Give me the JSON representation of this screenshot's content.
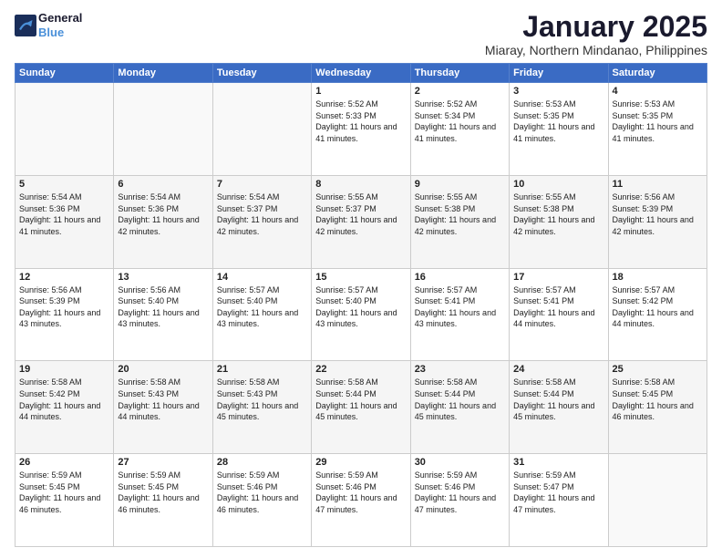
{
  "logo": {
    "line1": "General",
    "line2": "Blue"
  },
  "title": "January 2025",
  "location": "Miaray, Northern Mindanao, Philippines",
  "days_header": [
    "Sunday",
    "Monday",
    "Tuesday",
    "Wednesday",
    "Thursday",
    "Friday",
    "Saturday"
  ],
  "weeks": [
    [
      {
        "day": "",
        "sunrise": "",
        "sunset": "",
        "daylight": ""
      },
      {
        "day": "",
        "sunrise": "",
        "sunset": "",
        "daylight": ""
      },
      {
        "day": "",
        "sunrise": "",
        "sunset": "",
        "daylight": ""
      },
      {
        "day": "1",
        "sunrise": "Sunrise: 5:52 AM",
        "sunset": "Sunset: 5:33 PM",
        "daylight": "Daylight: 11 hours and 41 minutes."
      },
      {
        "day": "2",
        "sunrise": "Sunrise: 5:52 AM",
        "sunset": "Sunset: 5:34 PM",
        "daylight": "Daylight: 11 hours and 41 minutes."
      },
      {
        "day": "3",
        "sunrise": "Sunrise: 5:53 AM",
        "sunset": "Sunset: 5:35 PM",
        "daylight": "Daylight: 11 hours and 41 minutes."
      },
      {
        "day": "4",
        "sunrise": "Sunrise: 5:53 AM",
        "sunset": "Sunset: 5:35 PM",
        "daylight": "Daylight: 11 hours and 41 minutes."
      }
    ],
    [
      {
        "day": "5",
        "sunrise": "Sunrise: 5:54 AM",
        "sunset": "Sunset: 5:36 PM",
        "daylight": "Daylight: 11 hours and 41 minutes."
      },
      {
        "day": "6",
        "sunrise": "Sunrise: 5:54 AM",
        "sunset": "Sunset: 5:36 PM",
        "daylight": "Daylight: 11 hours and 42 minutes."
      },
      {
        "day": "7",
        "sunrise": "Sunrise: 5:54 AM",
        "sunset": "Sunset: 5:37 PM",
        "daylight": "Daylight: 11 hours and 42 minutes."
      },
      {
        "day": "8",
        "sunrise": "Sunrise: 5:55 AM",
        "sunset": "Sunset: 5:37 PM",
        "daylight": "Daylight: 11 hours and 42 minutes."
      },
      {
        "day": "9",
        "sunrise": "Sunrise: 5:55 AM",
        "sunset": "Sunset: 5:38 PM",
        "daylight": "Daylight: 11 hours and 42 minutes."
      },
      {
        "day": "10",
        "sunrise": "Sunrise: 5:55 AM",
        "sunset": "Sunset: 5:38 PM",
        "daylight": "Daylight: 11 hours and 42 minutes."
      },
      {
        "day": "11",
        "sunrise": "Sunrise: 5:56 AM",
        "sunset": "Sunset: 5:39 PM",
        "daylight": "Daylight: 11 hours and 42 minutes."
      }
    ],
    [
      {
        "day": "12",
        "sunrise": "Sunrise: 5:56 AM",
        "sunset": "Sunset: 5:39 PM",
        "daylight": "Daylight: 11 hours and 43 minutes."
      },
      {
        "day": "13",
        "sunrise": "Sunrise: 5:56 AM",
        "sunset": "Sunset: 5:40 PM",
        "daylight": "Daylight: 11 hours and 43 minutes."
      },
      {
        "day": "14",
        "sunrise": "Sunrise: 5:57 AM",
        "sunset": "Sunset: 5:40 PM",
        "daylight": "Daylight: 11 hours and 43 minutes."
      },
      {
        "day": "15",
        "sunrise": "Sunrise: 5:57 AM",
        "sunset": "Sunset: 5:40 PM",
        "daylight": "Daylight: 11 hours and 43 minutes."
      },
      {
        "day": "16",
        "sunrise": "Sunrise: 5:57 AM",
        "sunset": "Sunset: 5:41 PM",
        "daylight": "Daylight: 11 hours and 43 minutes."
      },
      {
        "day": "17",
        "sunrise": "Sunrise: 5:57 AM",
        "sunset": "Sunset: 5:41 PM",
        "daylight": "Daylight: 11 hours and 44 minutes."
      },
      {
        "day": "18",
        "sunrise": "Sunrise: 5:57 AM",
        "sunset": "Sunset: 5:42 PM",
        "daylight": "Daylight: 11 hours and 44 minutes."
      }
    ],
    [
      {
        "day": "19",
        "sunrise": "Sunrise: 5:58 AM",
        "sunset": "Sunset: 5:42 PM",
        "daylight": "Daylight: 11 hours and 44 minutes."
      },
      {
        "day": "20",
        "sunrise": "Sunrise: 5:58 AM",
        "sunset": "Sunset: 5:43 PM",
        "daylight": "Daylight: 11 hours and 44 minutes."
      },
      {
        "day": "21",
        "sunrise": "Sunrise: 5:58 AM",
        "sunset": "Sunset: 5:43 PM",
        "daylight": "Daylight: 11 hours and 45 minutes."
      },
      {
        "day": "22",
        "sunrise": "Sunrise: 5:58 AM",
        "sunset": "Sunset: 5:44 PM",
        "daylight": "Daylight: 11 hours and 45 minutes."
      },
      {
        "day": "23",
        "sunrise": "Sunrise: 5:58 AM",
        "sunset": "Sunset: 5:44 PM",
        "daylight": "Daylight: 11 hours and 45 minutes."
      },
      {
        "day": "24",
        "sunrise": "Sunrise: 5:58 AM",
        "sunset": "Sunset: 5:44 PM",
        "daylight": "Daylight: 11 hours and 45 minutes."
      },
      {
        "day": "25",
        "sunrise": "Sunrise: 5:58 AM",
        "sunset": "Sunset: 5:45 PM",
        "daylight": "Daylight: 11 hours and 46 minutes."
      }
    ],
    [
      {
        "day": "26",
        "sunrise": "Sunrise: 5:59 AM",
        "sunset": "Sunset: 5:45 PM",
        "daylight": "Daylight: 11 hours and 46 minutes."
      },
      {
        "day": "27",
        "sunrise": "Sunrise: 5:59 AM",
        "sunset": "Sunset: 5:45 PM",
        "daylight": "Daylight: 11 hours and 46 minutes."
      },
      {
        "day": "28",
        "sunrise": "Sunrise: 5:59 AM",
        "sunset": "Sunset: 5:46 PM",
        "daylight": "Daylight: 11 hours and 46 minutes."
      },
      {
        "day": "29",
        "sunrise": "Sunrise: 5:59 AM",
        "sunset": "Sunset: 5:46 PM",
        "daylight": "Daylight: 11 hours and 47 minutes."
      },
      {
        "day": "30",
        "sunrise": "Sunrise: 5:59 AM",
        "sunset": "Sunset: 5:46 PM",
        "daylight": "Daylight: 11 hours and 47 minutes."
      },
      {
        "day": "31",
        "sunrise": "Sunrise: 5:59 AM",
        "sunset": "Sunset: 5:47 PM",
        "daylight": "Daylight: 11 hours and 47 minutes."
      },
      {
        "day": "",
        "sunrise": "",
        "sunset": "",
        "daylight": ""
      }
    ]
  ]
}
